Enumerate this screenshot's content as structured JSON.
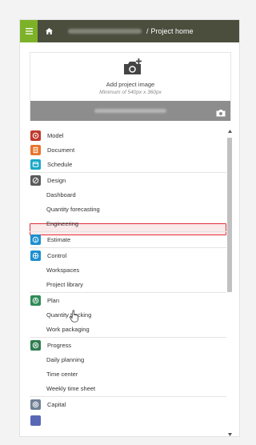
{
  "topbar": {
    "separator": "/",
    "current": "Project home"
  },
  "image_card": {
    "add_label": "Add project image",
    "min_label": "Minimum of 540px x 360px"
  },
  "nav": {
    "items": [
      {
        "label": "Model",
        "icon": "model-icon",
        "color": "#c0392b"
      },
      {
        "label": "Document",
        "icon": "document-icon",
        "color": "#e8742c"
      },
      {
        "label": "Schedule",
        "icon": "schedule-icon",
        "color": "#1ba9c6"
      },
      {
        "label": "Design",
        "icon": "design-icon",
        "color": "#5a5a5a"
      },
      {
        "label": "Dashboard"
      },
      {
        "label": "Quantity forecasting"
      },
      {
        "label": "Engineering"
      },
      {
        "label": "Estimate",
        "icon": "estimate-icon",
        "color": "#1b8fcf"
      },
      {
        "label": "Control",
        "icon": "control-icon",
        "color": "#1b8fcf"
      },
      {
        "label": "Workspaces"
      },
      {
        "label": "Project library"
      },
      {
        "label": "Plan",
        "icon": "plan-icon",
        "color": "#2e8b57"
      },
      {
        "label": "Quantity tracking"
      },
      {
        "label": "Work packaging"
      },
      {
        "label": "Progress",
        "icon": "progress-icon",
        "color": "#2e7d4f"
      },
      {
        "label": "Daily planning"
      },
      {
        "label": "Time center"
      },
      {
        "label": "Weekly time sheet"
      },
      {
        "label": "Capital",
        "icon": "capital-icon",
        "color": "#6f7f95"
      }
    ]
  },
  "colors": {
    "menu_button": "#7db228",
    "topbar": "#4b4e3d",
    "selection_border": "#e0303b"
  }
}
